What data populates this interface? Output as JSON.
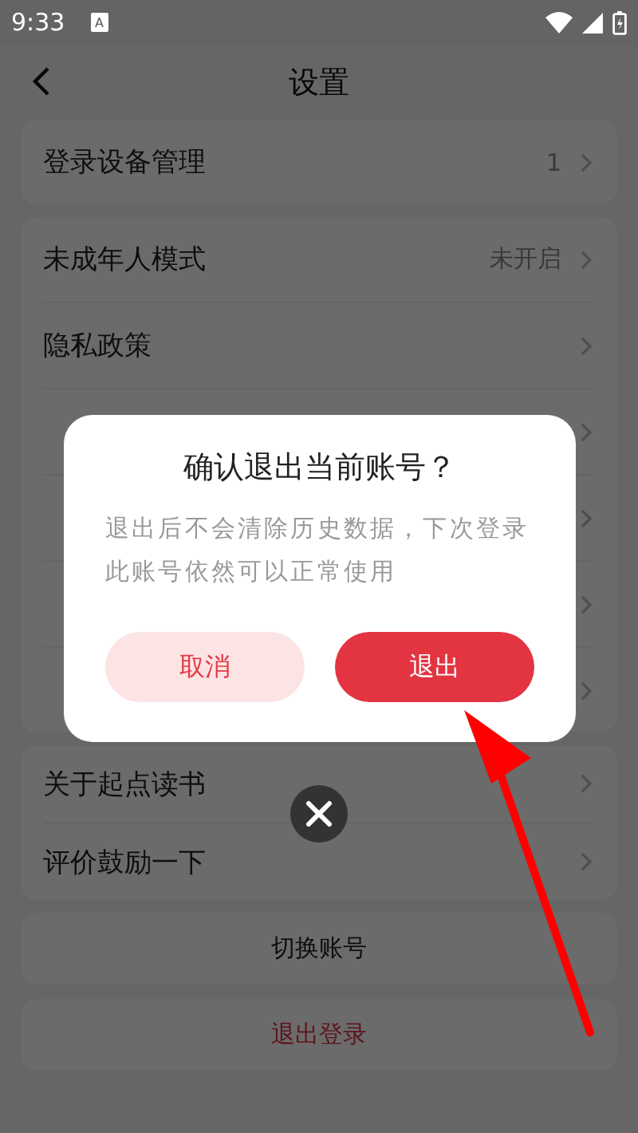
{
  "status_bar": {
    "time": "9:33",
    "notification_icon": "A"
  },
  "header": {
    "title": "设置"
  },
  "groups": [
    {
      "items": [
        {
          "label": "登录设备管理",
          "value": "1",
          "chevron": true
        }
      ]
    },
    {
      "items": [
        {
          "label": "未成年人模式",
          "value": "未开启",
          "chevron": true
        },
        {
          "label": "隐私政策",
          "chevron": true
        },
        {
          "chevron": true
        },
        {
          "chevron": true
        },
        {
          "chevron": true
        },
        {
          "chevron": true
        }
      ]
    },
    {
      "items": [
        {
          "label": "关于起点读书",
          "chevron": true
        },
        {
          "label": "评价鼓励一下",
          "chevron": true
        }
      ]
    }
  ],
  "actions": [
    {
      "label": "切换账号",
      "kind": "normal"
    },
    {
      "label": "退出登录",
      "kind": "danger"
    }
  ],
  "dialog": {
    "title": "确认退出当前账号？",
    "message": "退出后不会清除历史数据，下次登录此账号依然可以正常使用",
    "buttons": [
      {
        "label": "取消",
        "kind": "secondary"
      },
      {
        "label": "退出",
        "kind": "primary"
      }
    ]
  }
}
